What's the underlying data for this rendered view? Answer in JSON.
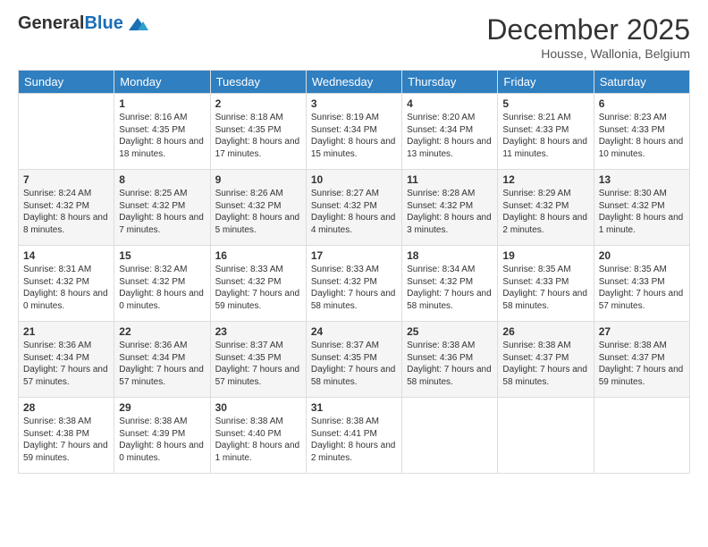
{
  "header": {
    "logo": {
      "general": "General",
      "blue": "Blue"
    },
    "title": "December 2025",
    "location": "Housse, Wallonia, Belgium"
  },
  "calendar": {
    "weekdays": [
      "Sunday",
      "Monday",
      "Tuesday",
      "Wednesday",
      "Thursday",
      "Friday",
      "Saturday"
    ],
    "weeks": [
      [
        {
          "day": "",
          "sunrise": "",
          "sunset": "",
          "daylight": ""
        },
        {
          "day": "1",
          "sunrise": "Sunrise: 8:16 AM",
          "sunset": "Sunset: 4:35 PM",
          "daylight": "Daylight: 8 hours and 18 minutes."
        },
        {
          "day": "2",
          "sunrise": "Sunrise: 8:18 AM",
          "sunset": "Sunset: 4:35 PM",
          "daylight": "Daylight: 8 hours and 17 minutes."
        },
        {
          "day": "3",
          "sunrise": "Sunrise: 8:19 AM",
          "sunset": "Sunset: 4:34 PM",
          "daylight": "Daylight: 8 hours and 15 minutes."
        },
        {
          "day": "4",
          "sunrise": "Sunrise: 8:20 AM",
          "sunset": "Sunset: 4:34 PM",
          "daylight": "Daylight: 8 hours and 13 minutes."
        },
        {
          "day": "5",
          "sunrise": "Sunrise: 8:21 AM",
          "sunset": "Sunset: 4:33 PM",
          "daylight": "Daylight: 8 hours and 11 minutes."
        },
        {
          "day": "6",
          "sunrise": "Sunrise: 8:23 AM",
          "sunset": "Sunset: 4:33 PM",
          "daylight": "Daylight: 8 hours and 10 minutes."
        }
      ],
      [
        {
          "day": "7",
          "sunrise": "Sunrise: 8:24 AM",
          "sunset": "Sunset: 4:32 PM",
          "daylight": "Daylight: 8 hours and 8 minutes."
        },
        {
          "day": "8",
          "sunrise": "Sunrise: 8:25 AM",
          "sunset": "Sunset: 4:32 PM",
          "daylight": "Daylight: 8 hours and 7 minutes."
        },
        {
          "day": "9",
          "sunrise": "Sunrise: 8:26 AM",
          "sunset": "Sunset: 4:32 PM",
          "daylight": "Daylight: 8 hours and 5 minutes."
        },
        {
          "day": "10",
          "sunrise": "Sunrise: 8:27 AM",
          "sunset": "Sunset: 4:32 PM",
          "daylight": "Daylight: 8 hours and 4 minutes."
        },
        {
          "day": "11",
          "sunrise": "Sunrise: 8:28 AM",
          "sunset": "Sunset: 4:32 PM",
          "daylight": "Daylight: 8 hours and 3 minutes."
        },
        {
          "day": "12",
          "sunrise": "Sunrise: 8:29 AM",
          "sunset": "Sunset: 4:32 PM",
          "daylight": "Daylight: 8 hours and 2 minutes."
        },
        {
          "day": "13",
          "sunrise": "Sunrise: 8:30 AM",
          "sunset": "Sunset: 4:32 PM",
          "daylight": "Daylight: 8 hours and 1 minute."
        }
      ],
      [
        {
          "day": "14",
          "sunrise": "Sunrise: 8:31 AM",
          "sunset": "Sunset: 4:32 PM",
          "daylight": "Daylight: 8 hours and 0 minutes."
        },
        {
          "day": "15",
          "sunrise": "Sunrise: 8:32 AM",
          "sunset": "Sunset: 4:32 PM",
          "daylight": "Daylight: 8 hours and 0 minutes."
        },
        {
          "day": "16",
          "sunrise": "Sunrise: 8:33 AM",
          "sunset": "Sunset: 4:32 PM",
          "daylight": "Daylight: 7 hours and 59 minutes."
        },
        {
          "day": "17",
          "sunrise": "Sunrise: 8:33 AM",
          "sunset": "Sunset: 4:32 PM",
          "daylight": "Daylight: 7 hours and 58 minutes."
        },
        {
          "day": "18",
          "sunrise": "Sunrise: 8:34 AM",
          "sunset": "Sunset: 4:32 PM",
          "daylight": "Daylight: 7 hours and 58 minutes."
        },
        {
          "day": "19",
          "sunrise": "Sunrise: 8:35 AM",
          "sunset": "Sunset: 4:33 PM",
          "daylight": "Daylight: 7 hours and 58 minutes."
        },
        {
          "day": "20",
          "sunrise": "Sunrise: 8:35 AM",
          "sunset": "Sunset: 4:33 PM",
          "daylight": "Daylight: 7 hours and 57 minutes."
        }
      ],
      [
        {
          "day": "21",
          "sunrise": "Sunrise: 8:36 AM",
          "sunset": "Sunset: 4:34 PM",
          "daylight": "Daylight: 7 hours and 57 minutes."
        },
        {
          "day": "22",
          "sunrise": "Sunrise: 8:36 AM",
          "sunset": "Sunset: 4:34 PM",
          "daylight": "Daylight: 7 hours and 57 minutes."
        },
        {
          "day": "23",
          "sunrise": "Sunrise: 8:37 AM",
          "sunset": "Sunset: 4:35 PM",
          "daylight": "Daylight: 7 hours and 57 minutes."
        },
        {
          "day": "24",
          "sunrise": "Sunrise: 8:37 AM",
          "sunset": "Sunset: 4:35 PM",
          "daylight": "Daylight: 7 hours and 58 minutes."
        },
        {
          "day": "25",
          "sunrise": "Sunrise: 8:38 AM",
          "sunset": "Sunset: 4:36 PM",
          "daylight": "Daylight: 7 hours and 58 minutes."
        },
        {
          "day": "26",
          "sunrise": "Sunrise: 8:38 AM",
          "sunset": "Sunset: 4:37 PM",
          "daylight": "Daylight: 7 hours and 58 minutes."
        },
        {
          "day": "27",
          "sunrise": "Sunrise: 8:38 AM",
          "sunset": "Sunset: 4:37 PM",
          "daylight": "Daylight: 7 hours and 59 minutes."
        }
      ],
      [
        {
          "day": "28",
          "sunrise": "Sunrise: 8:38 AM",
          "sunset": "Sunset: 4:38 PM",
          "daylight": "Daylight: 7 hours and 59 minutes."
        },
        {
          "day": "29",
          "sunrise": "Sunrise: 8:38 AM",
          "sunset": "Sunset: 4:39 PM",
          "daylight": "Daylight: 8 hours and 0 minutes."
        },
        {
          "day": "30",
          "sunrise": "Sunrise: 8:38 AM",
          "sunset": "Sunset: 4:40 PM",
          "daylight": "Daylight: 8 hours and 1 minute."
        },
        {
          "day": "31",
          "sunrise": "Sunrise: 8:38 AM",
          "sunset": "Sunset: 4:41 PM",
          "daylight": "Daylight: 8 hours and 2 minutes."
        },
        {
          "day": "",
          "sunrise": "",
          "sunset": "",
          "daylight": ""
        },
        {
          "day": "",
          "sunrise": "",
          "sunset": "",
          "daylight": ""
        },
        {
          "day": "",
          "sunrise": "",
          "sunset": "",
          "daylight": ""
        }
      ]
    ]
  }
}
